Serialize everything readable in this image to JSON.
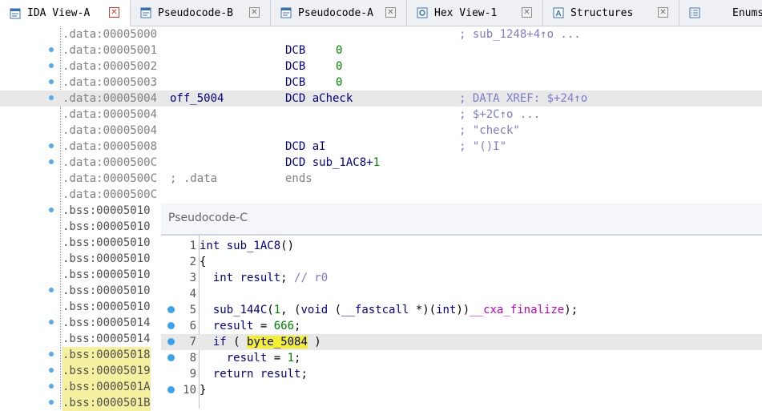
{
  "tabs": [
    {
      "label": "IDA View-A",
      "icon": "ida-view-icon",
      "active": true
    },
    {
      "label": "Pseudocode-B",
      "icon": "pseudocode-icon",
      "active": false
    },
    {
      "label": "Pseudocode-A",
      "icon": "pseudocode-icon",
      "active": false
    },
    {
      "label": "Hex View-1",
      "icon": "hex-view-icon",
      "active": false
    },
    {
      "label": "Structures",
      "icon": "structures-icon",
      "active": false
    },
    {
      "label": "Enums",
      "icon": "enums-icon",
      "active": false
    }
  ],
  "close_glyph": "✕",
  "disasm": {
    "rows": [
      {
        "dot": false,
        "addr": ".data:00005000",
        "label": "",
        "op": "",
        "arg": "",
        "cmt": "; sub_1248+4↑o ..."
      },
      {
        "dot": true,
        "addr": ".data:00005001",
        "label": "",
        "op": "DCB",
        "arg": "0",
        "cmt": ""
      },
      {
        "dot": true,
        "addr": ".data:00005002",
        "label": "",
        "op": "DCB",
        "arg": "0",
        "cmt": ""
      },
      {
        "dot": true,
        "addr": ".data:00005003",
        "label": "",
        "op": "DCB",
        "arg": "0",
        "cmt": ""
      },
      {
        "dot": true,
        "addr": ".data:00005004",
        "label": "off_5004",
        "op": "DCD",
        "arg": "aCheck",
        "cmt": "; DATA XREF: $+24↑o"
      },
      {
        "dot": false,
        "addr": ".data:00005004",
        "label": "",
        "op": "",
        "arg": "",
        "cmt": "; $+2C↑o ..."
      },
      {
        "dot": false,
        "addr": ".data:00005004",
        "label": "",
        "op": "",
        "arg": "",
        "cmt": "; \"check\""
      },
      {
        "dot": true,
        "addr": ".data:00005008",
        "label": "",
        "op": "DCD",
        "arg": "aI",
        "cmt": "; \"()I\""
      },
      {
        "dot": true,
        "addr": ".data:0000500C",
        "label": "",
        "op": "DCD",
        "arg": "sub_1AC8+1",
        "cmt": ""
      },
      {
        "dot": false,
        "addr": ".data:0000500C",
        "label": "; .data",
        "op": "ends",
        "arg": "",
        "cmt": ""
      },
      {
        "dot": false,
        "addr": ".data:0000500C",
        "label": "",
        "op": "",
        "arg": "",
        "cmt": ""
      },
      {
        "dot": true,
        "addr": ".bss:00005010",
        "label": "",
        "op": "",
        "arg": "",
        "cmt": ""
      },
      {
        "dot": false,
        "addr": ".bss:00005010",
        "label": "",
        "op": "",
        "arg": "",
        "cmt": ""
      },
      {
        "dot": false,
        "addr": ".bss:00005010",
        "label": "",
        "op": "",
        "arg": "",
        "cmt": ""
      },
      {
        "dot": false,
        "addr": ".bss:00005010",
        "label": "",
        "op": "",
        "arg": "",
        "cmt": ""
      },
      {
        "dot": false,
        "addr": ".bss:00005010",
        "label": "",
        "op": "",
        "arg": "",
        "cmt": ""
      },
      {
        "dot": true,
        "addr": ".bss:00005010",
        "label": "",
        "op": "",
        "arg": "",
        "cmt": ""
      },
      {
        "dot": false,
        "addr": ".bss:00005010",
        "label": "",
        "op": "",
        "arg": "",
        "cmt": ""
      },
      {
        "dot": true,
        "addr": ".bss:00005014",
        "label": "",
        "op": "",
        "arg": "",
        "cmt": ""
      },
      {
        "dot": false,
        "addr": ".bss:00005014",
        "label": "",
        "op": "",
        "arg": "",
        "cmt": ""
      },
      {
        "dot": true,
        "addr": ".bss:00005018",
        "label": "",
        "op": "",
        "arg": "",
        "cmt": ""
      },
      {
        "dot": true,
        "addr": ".bss:00005019",
        "label": "",
        "op": "",
        "arg": "",
        "cmt": ""
      },
      {
        "dot": true,
        "addr": ".bss:0000501A",
        "label": "",
        "op": "",
        "arg": "",
        "cmt": ""
      },
      {
        "dot": true,
        "addr": ".bss:0000501B",
        "label": "",
        "op": "",
        "arg": "",
        "cmt": ""
      }
    ]
  },
  "pseudocode": {
    "title": "Pseudocode-C",
    "lines": [
      {
        "n": "1",
        "dot": false,
        "parts": [
          [
            "kw",
            "int "
          ],
          [
            "fn",
            "sub_1AC8"
          ],
          [
            "plain",
            "()"
          ]
        ]
      },
      {
        "n": "2",
        "dot": false,
        "parts": [
          [
            "plain",
            "{"
          ]
        ]
      },
      {
        "n": "3",
        "dot": false,
        "parts": [
          [
            "kw",
            "  int "
          ],
          [
            "var",
            "result"
          ],
          [
            "plain",
            "; "
          ],
          [
            "cmt",
            "// r0"
          ]
        ]
      },
      {
        "n": "4",
        "dot": false,
        "parts": []
      },
      {
        "n": "5",
        "dot": true,
        "parts": [
          [
            "fn",
            "  sub_144C"
          ],
          [
            "plain",
            "("
          ],
          [
            "num",
            "1"
          ],
          [
            "plain",
            ", ("
          ],
          [
            "kw",
            "void"
          ],
          [
            "plain",
            " ("
          ],
          [
            "kw",
            "__fastcall"
          ],
          [
            "plain",
            " *)("
          ],
          [
            "kw",
            "int"
          ],
          [
            "plain",
            "))"
          ],
          [
            "imp",
            "__cxa_finalize"
          ],
          [
            "plain",
            ");"
          ]
        ]
      },
      {
        "n": "6",
        "dot": true,
        "parts": [
          [
            "var",
            "  result"
          ],
          [
            "plain",
            " = "
          ],
          [
            "num",
            "666"
          ],
          [
            "plain",
            ";"
          ]
        ]
      },
      {
        "n": "7",
        "dot": true,
        "parts": [
          [
            "kw",
            "  if"
          ],
          [
            "plain",
            " ( "
          ],
          [
            "hl",
            "byte_5084"
          ],
          [
            "plain",
            " )"
          ]
        ]
      },
      {
        "n": "8",
        "dot": true,
        "parts": [
          [
            "var",
            "    result"
          ],
          [
            "plain",
            " = "
          ],
          [
            "num",
            "1"
          ],
          [
            "plain",
            ";"
          ]
        ]
      },
      {
        "n": "9",
        "dot": false,
        "parts": [
          [
            "kw",
            "  return "
          ],
          [
            "var",
            "result"
          ],
          [
            "plain",
            ";"
          ]
        ]
      },
      {
        "n": "10",
        "dot": true,
        "parts": [
          [
            "plain",
            "}"
          ]
        ]
      }
    ]
  }
}
